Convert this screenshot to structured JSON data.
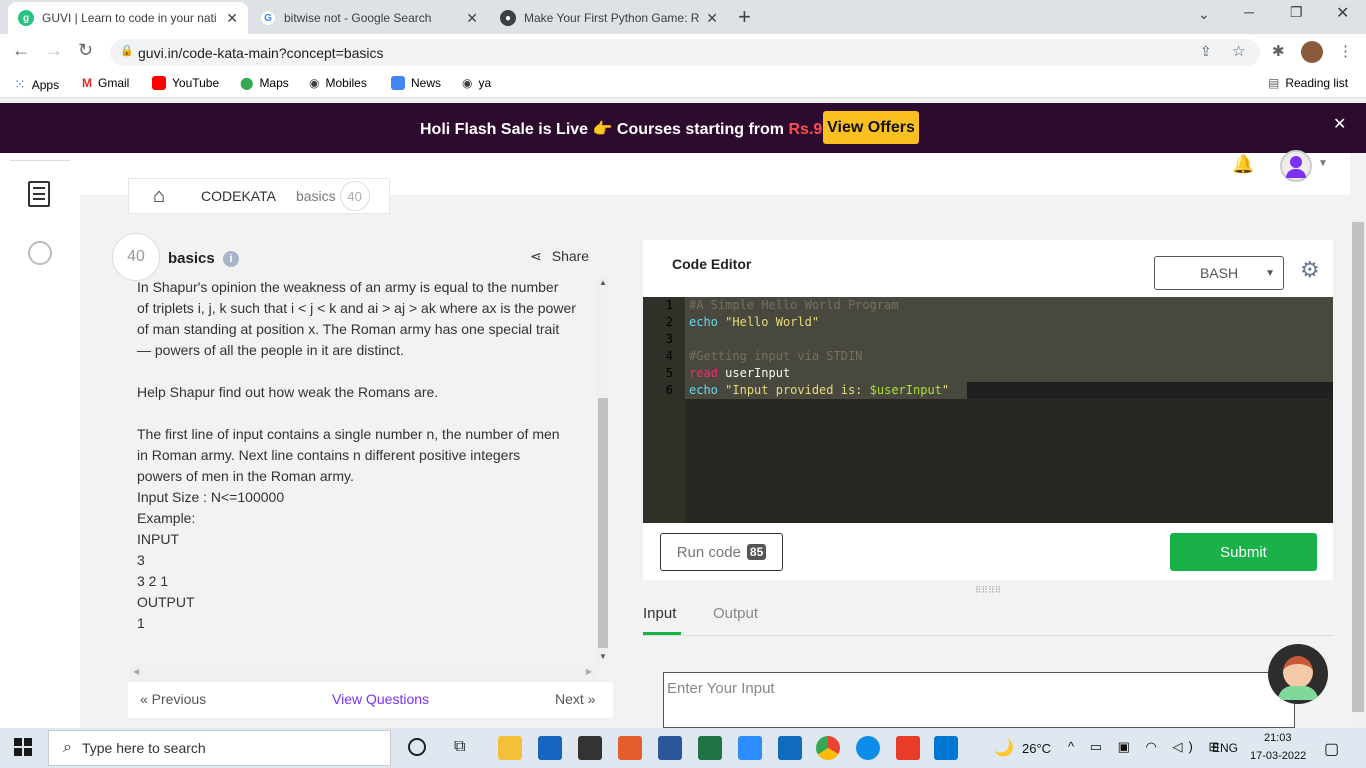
{
  "browser": {
    "tabs": [
      {
        "title": "GUVI | Learn to code in your nati",
        "close": "✕"
      },
      {
        "title": "bitwise not - Google Search",
        "close": "✕"
      },
      {
        "title": "Make Your First Python Game: Ro",
        "close": "✕"
      }
    ],
    "new_tab": "+",
    "url": "guvi.in/code-kata-main?concept=basics",
    "bookmarks": [
      "Apps",
      "Gmail",
      "YouTube",
      "Maps",
      "Mobiles",
      "News",
      "ya"
    ],
    "reading_list": "Reading list"
  },
  "banner": {
    "part1": "Holi Flash Sale is Live",
    "emoji": "👉",
    "part2": "Courses starting from",
    "price": "Rs.9",
    "button": "View Offers"
  },
  "breadcrumb": {
    "codekata": "CODEKATA",
    "basics": "basics",
    "count": "40"
  },
  "problem": {
    "points": "40",
    "title": "basics",
    "share": "Share",
    "text": "In Shapur's opinion the weakness of an army is equal to the number\nof triplets i, j, k such that i < j < k and ai > aj > ak where ax is the power\nof man standing at position x. The Roman army has one special trait\n— powers of all the people in it are distinct.\n\nHelp Shapur find out how weak the Romans are.\n\nThe first line of input contains a single number n, the number of men\nin Roman army. Next line contains n different positive integers\npowers of men in the Roman army.\nInput Size : N<=100000\nExample:\nINPUT\n3\n3 2 1\nOUTPUT\n1",
    "previous": "« Previous",
    "view_questions": "View Questions",
    "next": "Next »"
  },
  "editor": {
    "title": "Code Editor",
    "language": "BASH",
    "lines": [
      {
        "n": "1",
        "text": "#A Simple Hello World Program"
      },
      {
        "n": "2",
        "kw": "echo",
        "str": "\"Hello World\""
      },
      {
        "n": "3"
      },
      {
        "n": "4",
        "text": "#Getting input via STDIN"
      },
      {
        "n": "5",
        "kw": "read",
        "rest": "userInput"
      },
      {
        "n": "6",
        "kw": "echo",
        "str1": "\"Input provided is: ",
        "var": "$userInput",
        "str2": "\""
      }
    ],
    "run_code": "Run code",
    "run_count": "85",
    "submit": "Submit",
    "tab_input": "Input",
    "tab_output": "Output",
    "input_placeholder": "Enter Your Input"
  },
  "taskbar": {
    "search_placeholder": "Type here to search",
    "weather": "26°C",
    "lang": "ENG",
    "time": "21:03",
    "date": "17-03-2022"
  },
  "colors": {
    "banner_bg": "#2d0b2e",
    "offers_bg": "#f9c020",
    "submit_bg": "#1ab248",
    "accent_purple": "#7b2ff7"
  }
}
